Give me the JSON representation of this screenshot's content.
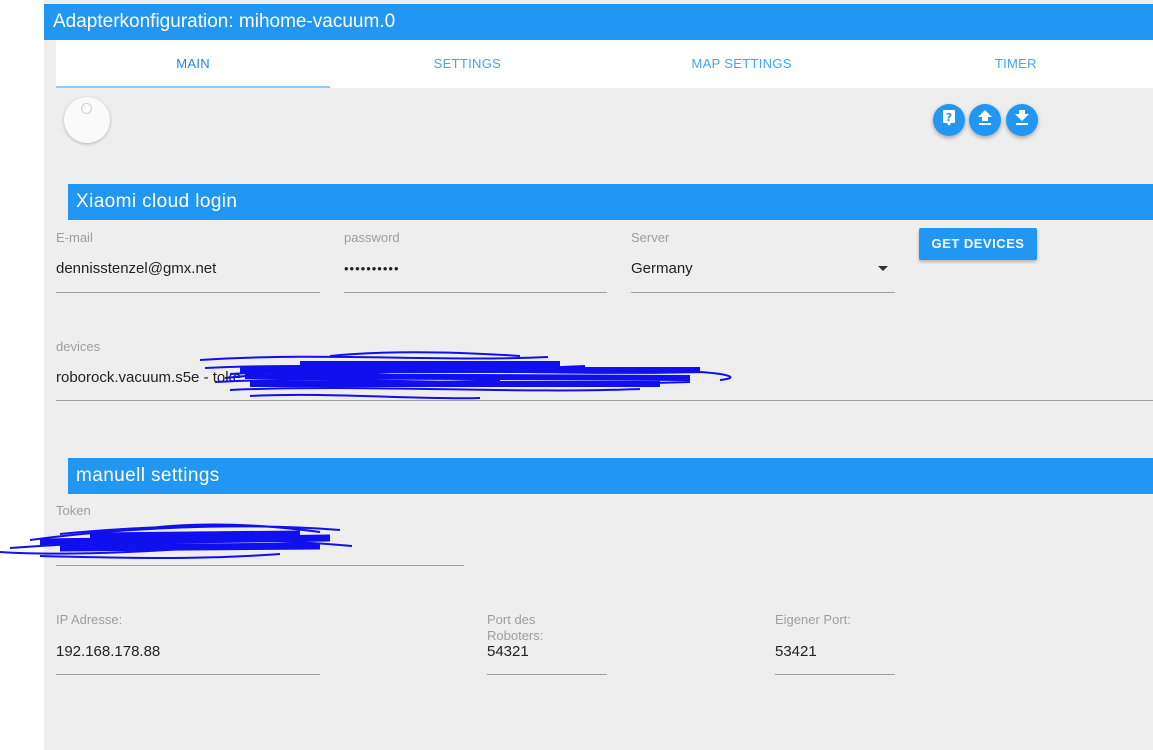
{
  "window": {
    "title": "Adapterkonfiguration: mihome-vacuum.0"
  },
  "tabs": [
    {
      "label": "MAIN",
      "active": true
    },
    {
      "label": "SETTINGS",
      "active": false
    },
    {
      "label": "MAP SETTINGS",
      "active": false
    },
    {
      "label": "TIMER",
      "active": false
    }
  ],
  "toolbar": {
    "help_icon": "help-icon",
    "upload_icon": "upload-icon",
    "download_icon": "download-icon"
  },
  "cloud_login": {
    "title": "Xiaomi cloud login",
    "email_label": "E-mail",
    "email_value": "dennisstenzel@gmx.net",
    "password_label": "password",
    "password_value": "••••••••••",
    "server_label": "Server",
    "server_value": "Germany",
    "get_devices_label": "GET DEVICES",
    "devices_label": "devices",
    "devices_value": "roborock.vacuum.s5e - toke"
  },
  "manual": {
    "title": "manuell settings",
    "token_label": "Token",
    "token_value": "",
    "ip_label": "IP Adresse:",
    "ip_value": "192.168.178.88",
    "port_label": "Port des Roboters:",
    "port_value": "54321",
    "own_port_label": "Eigener Port:",
    "own_port_value": "53421"
  },
  "colors": {
    "accent": "#2196f3",
    "background": "#eeeeee",
    "scribble": "#1010ee"
  }
}
